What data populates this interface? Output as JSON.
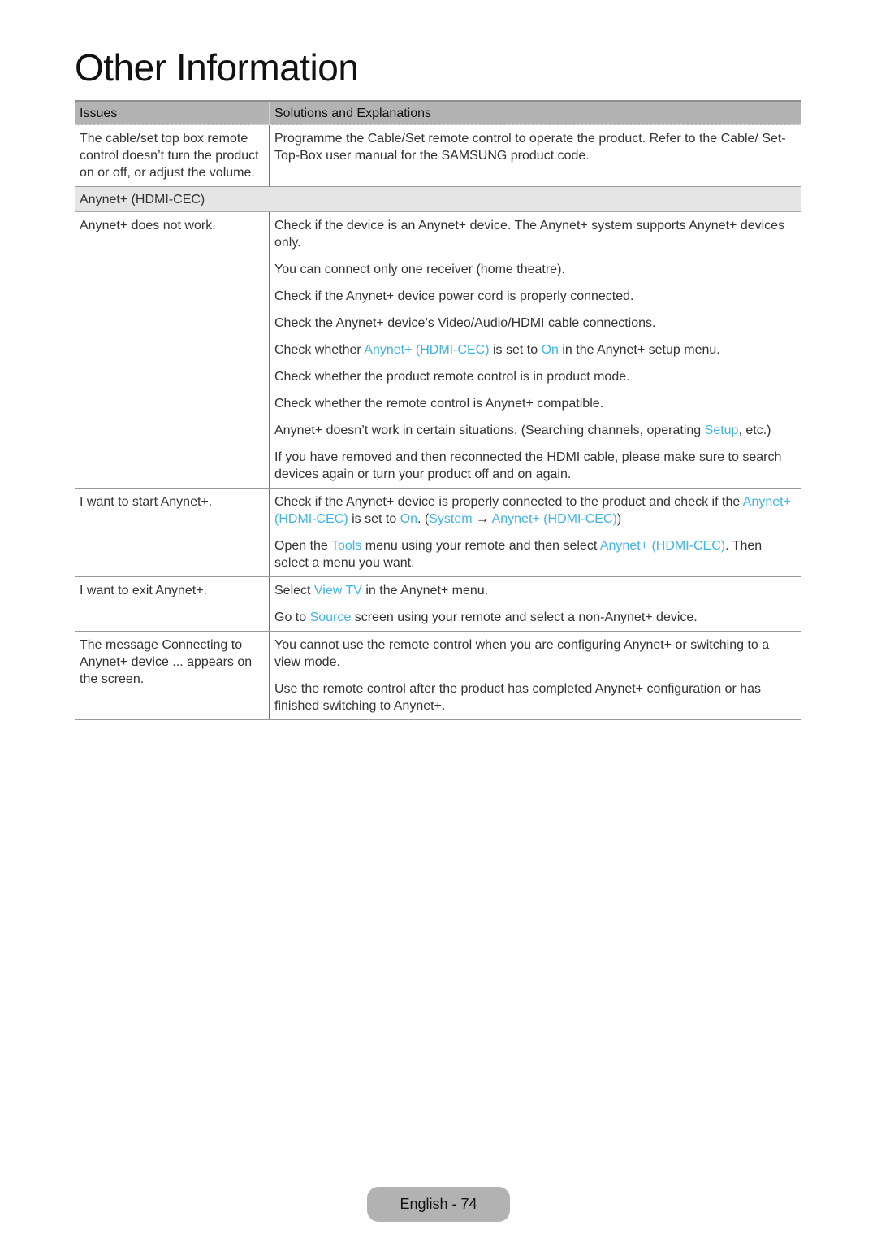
{
  "page": {
    "title": "Other Information",
    "footer_label": "English - 74"
  },
  "table": {
    "headers": [
      "Issues",
      "Solutions and Explanations"
    ],
    "highlight_color": "#3fb4e8",
    "rows": [
      {
        "issue": "The cable/set top box remote control doesn’t turn the product on or off, or adjust the volume.",
        "solutions": [
          [
            {
              "t": "Programme the Cable/Set remote control to operate the product. Refer to the Cable/ Set-Top-Box user manual for the SAMSUNG product code."
            }
          ]
        ]
      }
    ],
    "section": {
      "title": "Anynet+ (HDMI-CEC)",
      "rows": [
        {
          "issue": "Anynet+ does not work.",
          "solutions": [
            [
              {
                "t": "Check if the device is an Anynet+ device. The Anynet+ system supports Anynet+ devices only."
              }
            ],
            [
              {
                "t": "You can connect only one receiver (home theatre)."
              }
            ],
            [
              {
                "t": "Check if the Anynet+ device power cord is properly connected."
              }
            ],
            [
              {
                "t": "Check the Anynet+ device’s Video/Audio/HDMI cable connections."
              }
            ],
            [
              {
                "t": "Check whether "
              },
              {
                "t": "Anynet+ (HDMI-CEC)",
                "h": true
              },
              {
                "t": " is set to "
              },
              {
                "t": "On",
                "h": true
              },
              {
                "t": " in the Anynet+ setup menu."
              }
            ],
            [
              {
                "t": "Check whether the product remote control is in product mode."
              }
            ],
            [
              {
                "t": "Check whether the remote control is Anynet+ compatible."
              }
            ],
            [
              {
                "t": "Anynet+ doesn’t work in certain situations. (Searching channels, operating "
              },
              {
                "t": "Setup",
                "h": true
              },
              {
                "t": ", etc.)"
              }
            ],
            [
              {
                "t": "If you have removed and then reconnected the HDMI cable, please make sure to search devices again or turn your product off and on again."
              }
            ]
          ]
        },
        {
          "issue": "I want to start Anynet+.",
          "solutions": [
            [
              {
                "t": "Check if the Anynet+ device is properly connected to the product and check if the "
              },
              {
                "t": "Anynet+ (HDMI-CEC)",
                "h": true
              },
              {
                "t": " is set to "
              },
              {
                "t": "On",
                "h": true
              },
              {
                "t": ". ("
              },
              {
                "t": "System",
                "h": true
              },
              {
                "t": " → "
              },
              {
                "t": "Anynet+ (HDMI-CEC)",
                "h": true
              },
              {
                "t": ")"
              }
            ],
            [
              {
                "t": "Open the "
              },
              {
                "t": "Tools",
                "h": true
              },
              {
                "t": " menu using your remote and then select "
              },
              {
                "t": "Anynet+ (HDMI-CEC)",
                "h": true
              },
              {
                "t": ". Then select a menu you want."
              }
            ]
          ]
        },
        {
          "issue": "I want to exit Anynet+.",
          "solutions": [
            [
              {
                "t": "Select "
              },
              {
                "t": "View TV",
                "h": true
              },
              {
                "t": " in the Anynet+ menu."
              }
            ],
            [
              {
                "t": "Go to "
              },
              {
                "t": "Source",
                "h": true
              },
              {
                "t": " screen using your remote and select a non-Anynet+ device."
              }
            ]
          ]
        },
        {
          "issue": "The message Connecting to Anynet+ device ... appears on the screen.",
          "solutions": [
            [
              {
                "t": "You cannot use the remote control when you are configuring Anynet+ or switching to a view mode."
              }
            ],
            [
              {
                "t": "Use the remote control after the product has completed Anynet+ configuration or has finished switching to Anynet+."
              }
            ]
          ]
        }
      ]
    }
  }
}
